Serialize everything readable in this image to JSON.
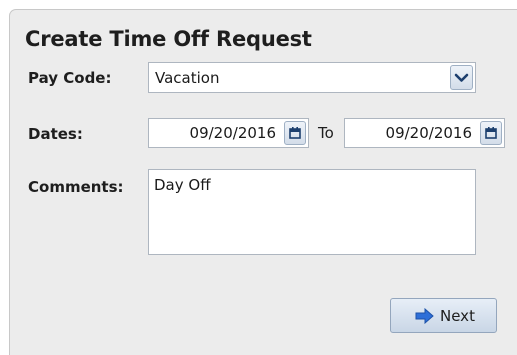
{
  "form": {
    "title": "Create Time Off Request",
    "pay_code": {
      "label": "Pay Code:",
      "selected": "Vacation"
    },
    "dates": {
      "label": "Dates:",
      "start": "09/20/2016",
      "separator": "To",
      "end": "09/20/2016"
    },
    "comments": {
      "label": "Comments:",
      "value": "Day Off"
    },
    "next_label": "Next"
  },
  "icons": {
    "dropdown": "chevron-down-icon",
    "calendar": "calendar-icon",
    "next": "arrow-right-icon"
  },
  "colors": {
    "panel_bg": "#ececec",
    "button_gradient_top": "#e7eef7",
    "button_gradient_bottom": "#c9d6e6",
    "arrow": "#2e6fd8",
    "icon_dark": "#1c3f6e"
  }
}
